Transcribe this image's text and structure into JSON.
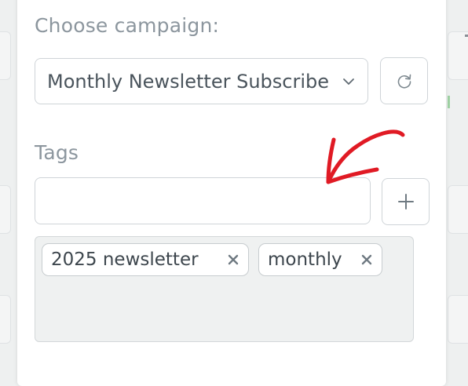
{
  "campaign": {
    "label": "Choose campaign:",
    "selected": "Monthly Newsletter Subscribers"
  },
  "tags": {
    "label": "Tags",
    "input_value": "",
    "items": [
      {
        "label": "2025 newsletter"
      },
      {
        "label": "monthly"
      }
    ]
  },
  "icons": {
    "chevron": "chevron-down-icon",
    "refresh": "refresh-icon",
    "add": "plus-icon",
    "remove": "close-icon",
    "annotation": "red-arrow"
  },
  "colors": {
    "annotation_arrow": "#e01a24",
    "muted_text": "#8c969e",
    "tags_box_bg": "#eff1f1"
  }
}
